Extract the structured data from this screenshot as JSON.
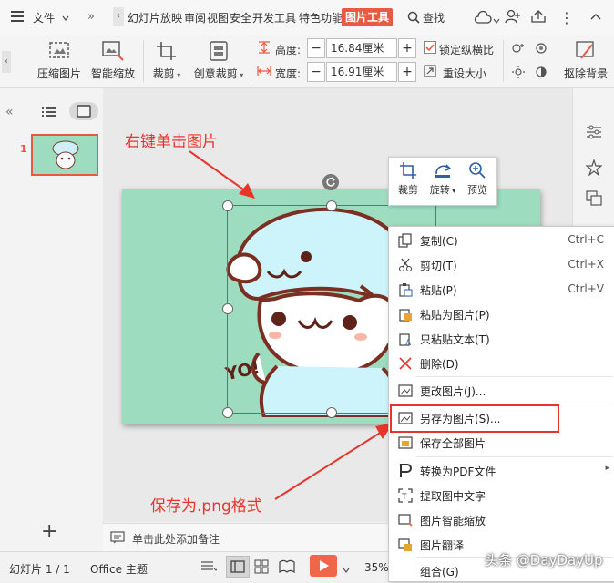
{
  "menubar": {
    "menu_icon": "hamburger-icon",
    "file_label": "文件",
    "tabs": [
      "幻灯片放映",
      "审阅",
      "视图",
      "安全",
      "开发工具",
      "特色功能"
    ],
    "active_tab": "图片工具",
    "search_label": "查找"
  },
  "ribbon": {
    "compress_label": "压缩图片",
    "smart_zoom_label": "智能缩放",
    "crop_label": "裁剪",
    "creative_crop_label": "创意裁剪",
    "height_label": "高度:",
    "height_value": "16.84厘米",
    "width_label": "宽度:",
    "width_value": "16.91厘米",
    "lock_ratio_label": "锁定纵横比",
    "lock_ratio_checked": true,
    "reset_size_label": "重设大小",
    "remove_bg_label": "抠除背景"
  },
  "thumbnails": [
    {
      "number": "1"
    }
  ],
  "annotations": {
    "top": "右键单击图片",
    "bottom": "保存为.png格式"
  },
  "slide_picture_text": "YO!",
  "mini_toolbar": [
    {
      "label": "裁剪",
      "icon": "crop-icon"
    },
    {
      "label": "旋转",
      "icon": "rotate-icon"
    },
    {
      "label": "预览",
      "icon": "zoom-in-icon"
    }
  ],
  "context_menu": [
    {
      "label": "复制(C)",
      "shortcut": "Ctrl+C",
      "icon": "copy-icon"
    },
    {
      "label": "剪切(T)",
      "shortcut": "Ctrl+X",
      "icon": "scissors-icon"
    },
    {
      "label": "粘贴(P)",
      "shortcut": "Ctrl+V",
      "icon": "paste-icon"
    },
    {
      "label": "粘贴为图片(P)",
      "shortcut": "",
      "icon": "paste-image-icon"
    },
    {
      "label": "只粘贴文本(T)",
      "shortcut": "",
      "icon": "paste-text-icon"
    },
    {
      "label": "删除(D)",
      "shortcut": "",
      "icon": "delete-icon"
    },
    {
      "label": "更改图片(J)...",
      "shortcut": "",
      "icon": "change-image-icon"
    },
    {
      "label": "另存为图片(S)...",
      "shortcut": "",
      "icon": "save-image-icon"
    },
    {
      "label": "保存全部图片",
      "shortcut": "",
      "icon": "save-all-images-icon"
    },
    {
      "label": "转换为PDF文件",
      "shortcut": "",
      "icon": "pdf-icon"
    },
    {
      "label": "提取图中文字",
      "shortcut": "",
      "icon": "ocr-icon"
    },
    {
      "label": "图片智能缩放",
      "shortcut": "",
      "icon": "smart-zoom-icon"
    },
    {
      "label": "图片翻译",
      "shortcut": "",
      "icon": "translate-icon"
    },
    {
      "label": "组合(G)",
      "shortcut": "",
      "icon": "group-icon"
    }
  ],
  "notes": {
    "placeholder": "单击此处添加备注"
  },
  "status": {
    "slide_indicator": "幻灯片 1 / 1",
    "theme": "Office 主题",
    "zoom": "35%"
  },
  "watermark": "头条 @DayDayUp",
  "colors": {
    "accent": "#e85a43",
    "annotation": "#e8352c",
    "slide_bg": "#9ddcbe",
    "play": "#f0664b"
  }
}
